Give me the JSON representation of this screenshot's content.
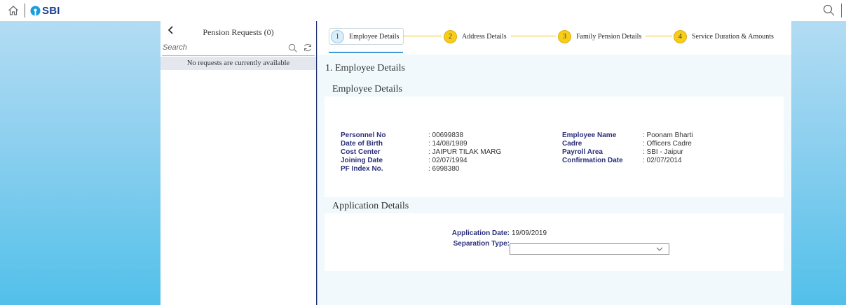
{
  "app": {
    "brand": "SBI",
    "colors": {
      "brand_blue": "#1a3f8f",
      "accent_yellow": "#f7cd1a",
      "label_navy": "#2a2f7a",
      "tab_blue": "#3a9bd6"
    }
  },
  "master": {
    "title": "Pension Requests (0)",
    "search_placeholder": "Search",
    "empty_text": "No requests are currently available"
  },
  "wizard": {
    "steps": [
      {
        "number": "1",
        "label": "Employee Details",
        "state": "current"
      },
      {
        "number": "2",
        "label": "Address Details",
        "state": "todo"
      },
      {
        "number": "3",
        "label": "Family Pension Details",
        "state": "todo"
      },
      {
        "number": "4",
        "label": "Service Duration & Amounts",
        "state": "todo"
      }
    ]
  },
  "section": {
    "heading": "1. Employee Details",
    "employee_title": "Employee Details",
    "application_title": "Application Details"
  },
  "employee": {
    "left": [
      {
        "label": "Personnel No",
        "value": ": 00699838"
      },
      {
        "label": "Date of Birth",
        "value": ": 14/08/1989"
      },
      {
        "label": "Cost Center",
        "value": ": JAIPUR TILAK MARG"
      },
      {
        "label": "Joining Date",
        "value": ": 02/07/1994"
      },
      {
        "label": "PF Index No.",
        "value": ": 6998380"
      }
    ],
    "right": [
      {
        "label": "Employee Name",
        "value": ": Poonam Bharti"
      },
      {
        "label": "Cadre",
        "value": ": Officers Cadre"
      },
      {
        "label": "Payroll Area",
        "value": ": SBI - Jaipur"
      },
      {
        "label": "Confirmation Date",
        "value": ": 02/07/2014"
      }
    ]
  },
  "application": {
    "date_label": "Application Date:",
    "date_value": "19/09/2019",
    "separation_label": "Separation Type:",
    "separation_value": ""
  },
  "icons": {
    "home": "home-icon",
    "search": "search-icon",
    "back": "chevron-left-icon",
    "refresh": "refresh-icon",
    "dropdown": "chevron-down-icon"
  }
}
